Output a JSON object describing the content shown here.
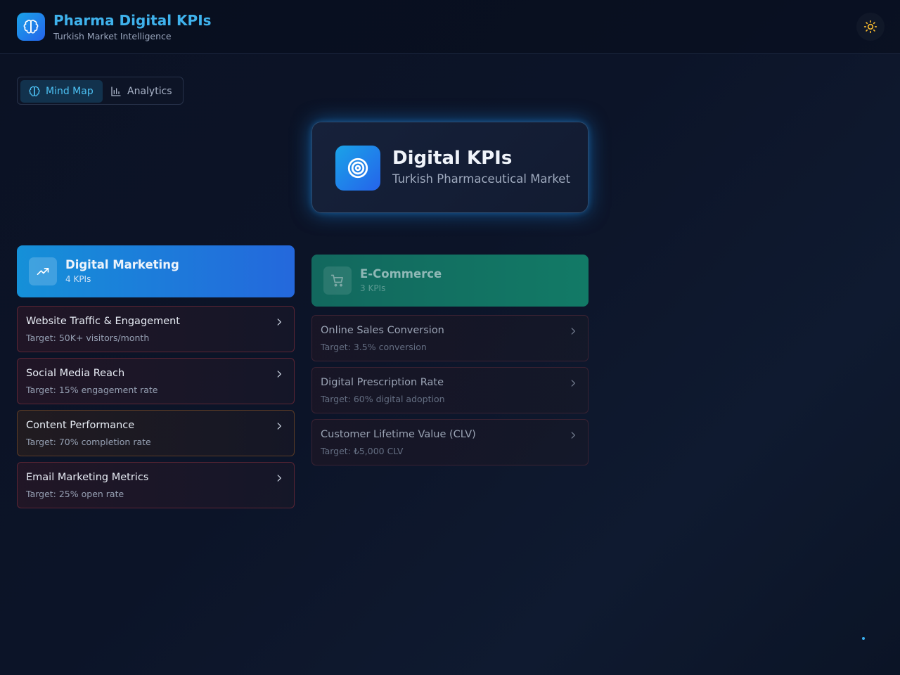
{
  "header": {
    "title": "Pharma Digital KPIs",
    "subtitle": "Turkish Market Intelligence",
    "logo_icon": "brain-icon",
    "theme_icon": "sun-icon"
  },
  "view_toggle": {
    "mindmap_label": "Mind Map",
    "analytics_label": "Analytics",
    "active": "Mind Map"
  },
  "center": {
    "title": "Digital KPIs",
    "subtitle": "Turkish Pharmaceutical Market",
    "icon": "target-icon"
  },
  "categories": [
    {
      "title": "Digital Marketing",
      "count": "4 KPIs",
      "icon": "trending-up-icon",
      "color": "#1a8fe0",
      "kpis": [
        {
          "name": "Website Traffic & Engagement",
          "target": "Target: 50K+ visitors/month"
        },
        {
          "name": "Social Media Reach",
          "target": "Target: 15% engagement rate"
        },
        {
          "name": "Content Performance",
          "target": "Target: 70% completion rate"
        },
        {
          "name": "Email Marketing Metrics",
          "target": "Target: 25% open rate"
        }
      ]
    },
    {
      "title": "E-Commerce",
      "count": "3 KPIs",
      "icon": "cart-icon",
      "color": "#127a66",
      "kpis": [
        {
          "name": "Online Sales Conversion",
          "target": "Target: 3.5% conversion"
        },
        {
          "name": "Digital Prescription Rate",
          "target": "Target: 60% digital adoption"
        },
        {
          "name": "Customer Lifetime Value (CLV)",
          "target": "Target: ₺5,000 CLV"
        }
      ]
    }
  ],
  "colors": {
    "accent": "#3fb2ec",
    "kpi_border": "#5a2534"
  }
}
